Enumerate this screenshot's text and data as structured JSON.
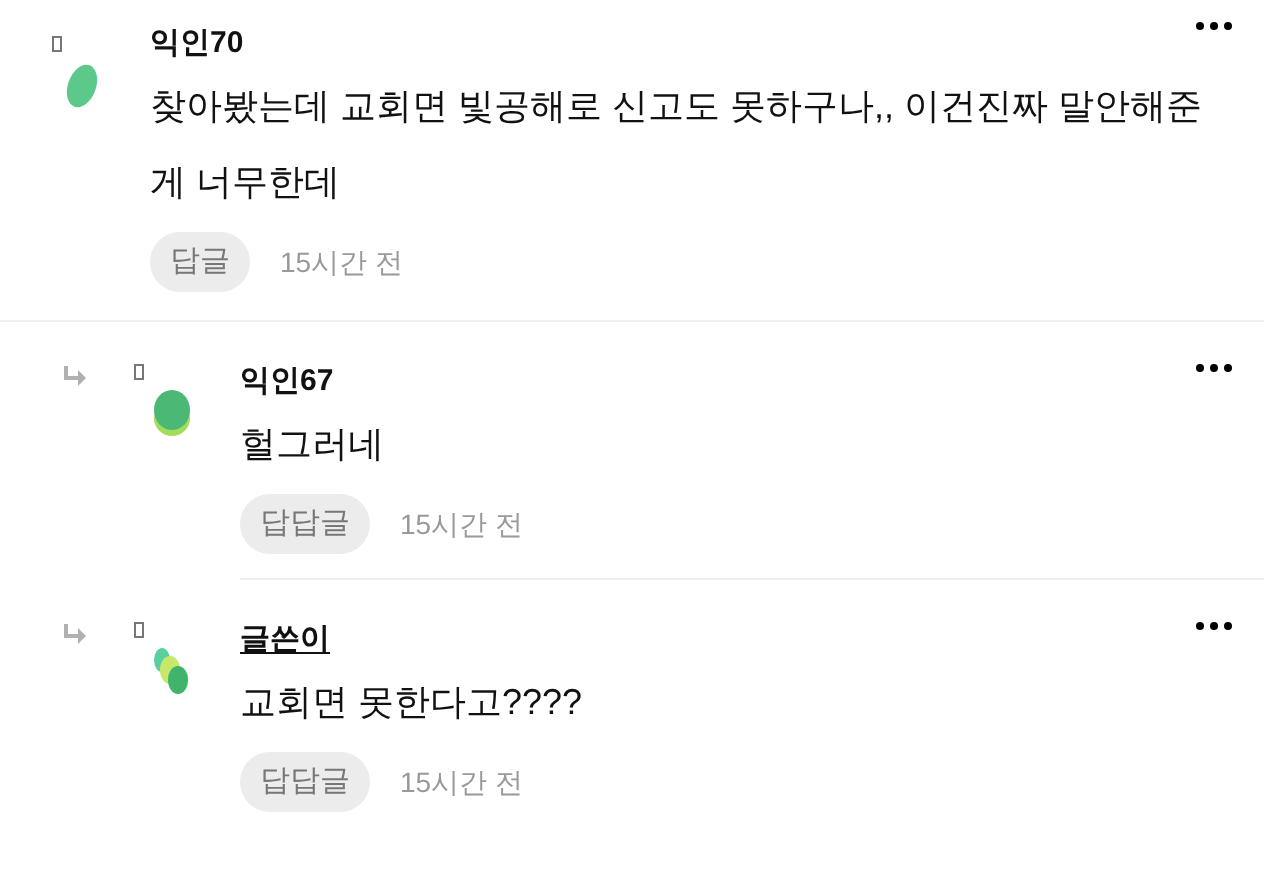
{
  "comments": [
    {
      "kind": "comment",
      "avatar": {
        "kind": "single"
      },
      "author": "익인70",
      "is_writer": false,
      "text": "찾아봤는데 교회면 빛공해로 신고도 못하구나,, 이건진짜 말안해준게 너무한데",
      "reply_button": "답글",
      "time": "15시간 전"
    },
    {
      "kind": "reply",
      "avatar": {
        "kind": "double"
      },
      "author": "익인67",
      "is_writer": false,
      "text": "헐그러네",
      "reply_button": "답답글",
      "time": "15시간 전"
    },
    {
      "kind": "reply",
      "avatar": {
        "kind": "triple"
      },
      "author": "글쓴이",
      "is_writer": true,
      "text": "교회면 못한다고????",
      "reply_button": "답답글",
      "time": "15시간 전"
    }
  ]
}
